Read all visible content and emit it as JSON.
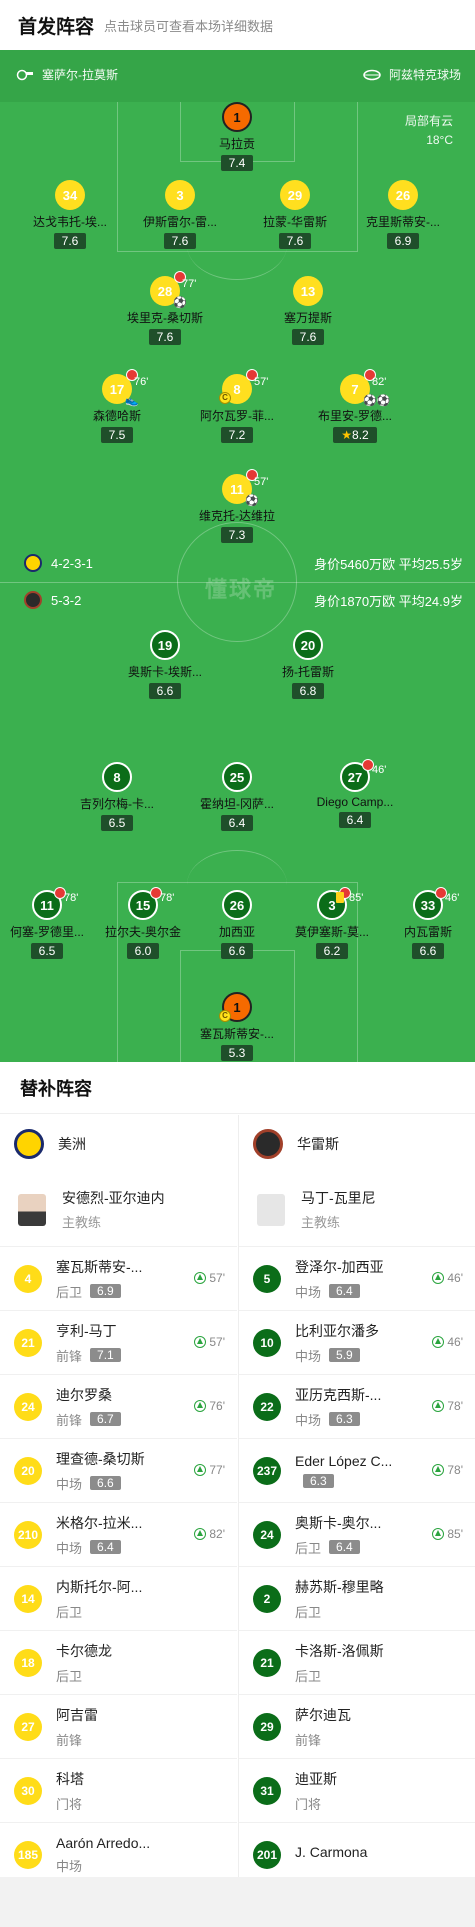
{
  "header": {
    "title": "首发阵容",
    "subtitle": "点击球员可查看本场详细数据"
  },
  "pitch": {
    "home_venue": "塞萨尔-拉莫斯",
    "away_venue": "阿兹特克球场",
    "weather": "局部有云",
    "temperature": "18°C",
    "watermark": "懂球帝",
    "home_formation": "4-2-3-1",
    "away_formation": "5-3-2",
    "home_value": "身价5460万欧 平均25.5岁",
    "away_value": "身价1870万欧 平均24.9岁",
    "colors": {
      "grass": "#3bb04f",
      "home_dot": "#ffdf1f",
      "away_dot": "#0b6d19",
      "gk_dot": "#f66a00"
    }
  },
  "home_players": [
    {
      "num": "1",
      "name": "马拉贡",
      "rating": "7.4"
    },
    {
      "num": "34",
      "name": "达戈韦托-埃...",
      "rating": "7.6"
    },
    {
      "num": "3",
      "name": "伊斯雷尔-雷...",
      "rating": "7.6"
    },
    {
      "num": "29",
      "name": "拉蒙-华雷斯",
      "rating": "7.6"
    },
    {
      "num": "26",
      "name": "克里斯蒂安-...",
      "rating": "6.9"
    },
    {
      "num": "28",
      "name": "埃里克-桑切斯",
      "rating": "7.6",
      "sub": "77'"
    },
    {
      "num": "13",
      "name": "塞万提斯",
      "rating": "7.6"
    },
    {
      "num": "17",
      "name": "森德哈斯",
      "rating": "7.5",
      "sub": "76'"
    },
    {
      "num": "8",
      "name": "阿尔瓦罗-菲...",
      "rating": "7.2",
      "sub": "57'"
    },
    {
      "num": "7",
      "name": "布里安-罗德...",
      "rating": "8.2",
      "sub": "82'"
    },
    {
      "num": "11",
      "name": "维克托-达维拉",
      "rating": "7.3",
      "sub": "57'"
    }
  ],
  "away_players": [
    {
      "num": "19",
      "name": "奥斯卡-埃斯...",
      "rating": "6.6"
    },
    {
      "num": "20",
      "name": "扬-托雷斯",
      "rating": "6.8"
    },
    {
      "num": "8",
      "name": "吉列尔梅-卡...",
      "rating": "6.5"
    },
    {
      "num": "25",
      "name": "霍纳坦-冈萨...",
      "rating": "6.4"
    },
    {
      "num": "27",
      "name": "Diego Camp...",
      "rating": "6.4",
      "sub": "46'"
    },
    {
      "num": "11",
      "name": "何塞-罗德里...",
      "rating": "6.5",
      "sub": "78'"
    },
    {
      "num": "15",
      "name": "拉尔夫-奥尔金",
      "rating": "6.0",
      "sub": "78'"
    },
    {
      "num": "26",
      "name": "加西亚",
      "rating": "6.6"
    },
    {
      "num": "3",
      "name": "莫伊塞斯-莫...",
      "rating": "6.2",
      "sub": "85'"
    },
    {
      "num": "33",
      "name": "内瓦雷斯",
      "rating": "6.6",
      "sub": "46'"
    },
    {
      "num": "1",
      "name": "塞瓦斯蒂安-...",
      "rating": "5.3"
    }
  ],
  "subs": {
    "title": "替补阵容",
    "home": {
      "team": "美洲",
      "coach": {
        "name": "安德烈-亚尔迪内",
        "role": "主教练"
      },
      "players": [
        {
          "num": "4",
          "name": "塞瓦斯蒂安-...",
          "pos": "后卫",
          "rating": "6.9",
          "in": "57'"
        },
        {
          "num": "21",
          "name": "亨利-马丁",
          "pos": "前锋",
          "rating": "7.1",
          "in": "57'"
        },
        {
          "num": "24",
          "name": "迪尔罗桑",
          "pos": "前锋",
          "rating": "6.7",
          "in": "76'"
        },
        {
          "num": "20",
          "name": "理查德-桑切斯",
          "pos": "中场",
          "rating": "6.6",
          "in": "77'"
        },
        {
          "num": "210",
          "name": "米格尔-拉米...",
          "pos": "中场",
          "rating": "6.4",
          "in": "82'"
        },
        {
          "num": "14",
          "name": "内斯托尔-阿...",
          "pos": "后卫"
        },
        {
          "num": "18",
          "name": "卡尔德龙",
          "pos": "后卫"
        },
        {
          "num": "27",
          "name": "阿吉雷",
          "pos": "前锋"
        },
        {
          "num": "30",
          "name": "科塔",
          "pos": "门将"
        },
        {
          "num": "185",
          "name": "Aarón Arredo...",
          "pos": "中场"
        }
      ]
    },
    "away": {
      "team": "华雷斯",
      "coach": {
        "name": "马丁-瓦里尼",
        "role": "主教练"
      },
      "players": [
        {
          "num": "5",
          "name": "登泽尔-加西亚",
          "pos": "中场",
          "rating": "6.4",
          "in": "46'"
        },
        {
          "num": "10",
          "name": "比利亚尔潘多",
          "pos": "中场",
          "rating": "5.9",
          "in": "46'"
        },
        {
          "num": "22",
          "name": "亚历克西斯-...",
          "pos": "中场",
          "rating": "6.3",
          "in": "78'"
        },
        {
          "num": "237",
          "name": "Eder López C...",
          "pos": "",
          "rating": "6.3",
          "in": "78'"
        },
        {
          "num": "24",
          "name": "奥斯卡-奥尔...",
          "pos": "后卫",
          "rating": "6.4",
          "in": "85'"
        },
        {
          "num": "2",
          "name": "赫苏斯-穆里略",
          "pos": "后卫"
        },
        {
          "num": "21",
          "name": "卡洛斯-洛佩斯",
          "pos": "后卫"
        },
        {
          "num": "29",
          "name": "萨尔迪瓦",
          "pos": "前锋"
        },
        {
          "num": "31",
          "name": "迪亚斯",
          "pos": "门将"
        },
        {
          "num": "201",
          "name": "J. Carmona",
          "pos": ""
        }
      ]
    }
  }
}
